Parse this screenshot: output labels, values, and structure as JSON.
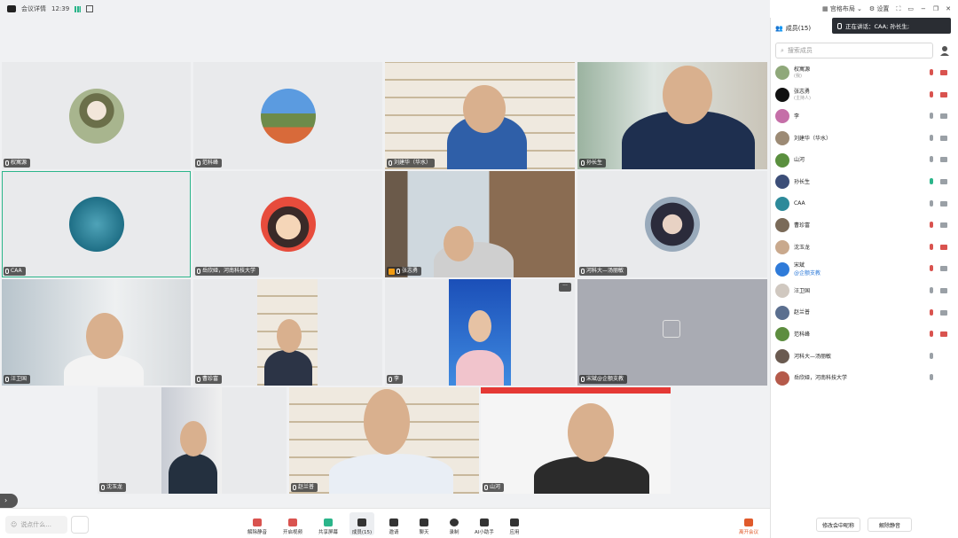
{
  "topbar": {
    "meeting_info": "会议详情",
    "time": "12:39",
    "layout_label": "宫格布局",
    "settings_label": "设置"
  },
  "speaking": {
    "text": "正在讲话：CAA; 孙长生;"
  },
  "panel": {
    "title": "成员(15)",
    "search_placeholder": "搜索成员",
    "rename_btn": "修改会中昵称",
    "unmute_btn": "解除静音"
  },
  "members": [
    {
      "name": "权寓源",
      "sub": "(我)",
      "color": "#8fa87a"
    },
    {
      "name": "张志勇",
      "sub": "(主持人)",
      "color": "#111"
    },
    {
      "name": "李",
      "sub": "",
      "color": "#c56fa8"
    },
    {
      "name": "刘建华（华水）",
      "sub": "",
      "color": "#9c8a74"
    },
    {
      "name": "山河",
      "sub": "",
      "color": "#5a8f3e"
    },
    {
      "name": "孙长生",
      "sub": "",
      "color": "#3c4e78"
    },
    {
      "name": "CAA",
      "sub": "",
      "color": "#2d8a9a"
    },
    {
      "name": "曹珍富",
      "sub": "",
      "color": "#7a6a58"
    },
    {
      "name": "沈玉龙",
      "sub": "",
      "color": "#c9a98d"
    },
    {
      "name": "宋斌",
      "sub": "@企额支教",
      "color": "#2f7bd9"
    },
    {
      "name": "汪卫国",
      "sub": "",
      "color": "#d0c8c0"
    },
    {
      "name": "赵兰普",
      "sub": "",
      "color": "#5b6f8f"
    },
    {
      "name": "范科峰",
      "sub": "",
      "color": "#5d8d3f"
    },
    {
      "name": "河科大—汤丽敏",
      "sub": "",
      "color": "#6a5a50"
    },
    {
      "name": "岳欣娅，河南科技大学",
      "sub": "",
      "color": "#b55a4a"
    }
  ],
  "tiles": [
    {
      "name": "权寓源"
    },
    {
      "name": "范科峰"
    },
    {
      "name": "刘建华（华水）"
    },
    {
      "name": "孙长生"
    },
    {
      "name": "CAA"
    },
    {
      "name": "岳欣娅，河南科技大学"
    },
    {
      "name": "张志勇"
    },
    {
      "name": "河科大—汤丽敏"
    },
    {
      "name": "汪卫国"
    },
    {
      "name": "曹珍富"
    },
    {
      "name": "李"
    },
    {
      "name": "宋斌@企额支教"
    },
    {
      "name": "沈玉龙"
    },
    {
      "name": "赵兰普"
    },
    {
      "name": "山河"
    }
  ],
  "toolbar": {
    "chat_placeholder": "说点什么...",
    "mute": "解除静音",
    "video": "开启视频",
    "share": "共享屏幕",
    "members": "成员(15)",
    "invite": "邀请",
    "chat": "聊天",
    "record": "录制",
    "ai": "AI小助手",
    "apps": "应用",
    "leave": "离开会议"
  }
}
